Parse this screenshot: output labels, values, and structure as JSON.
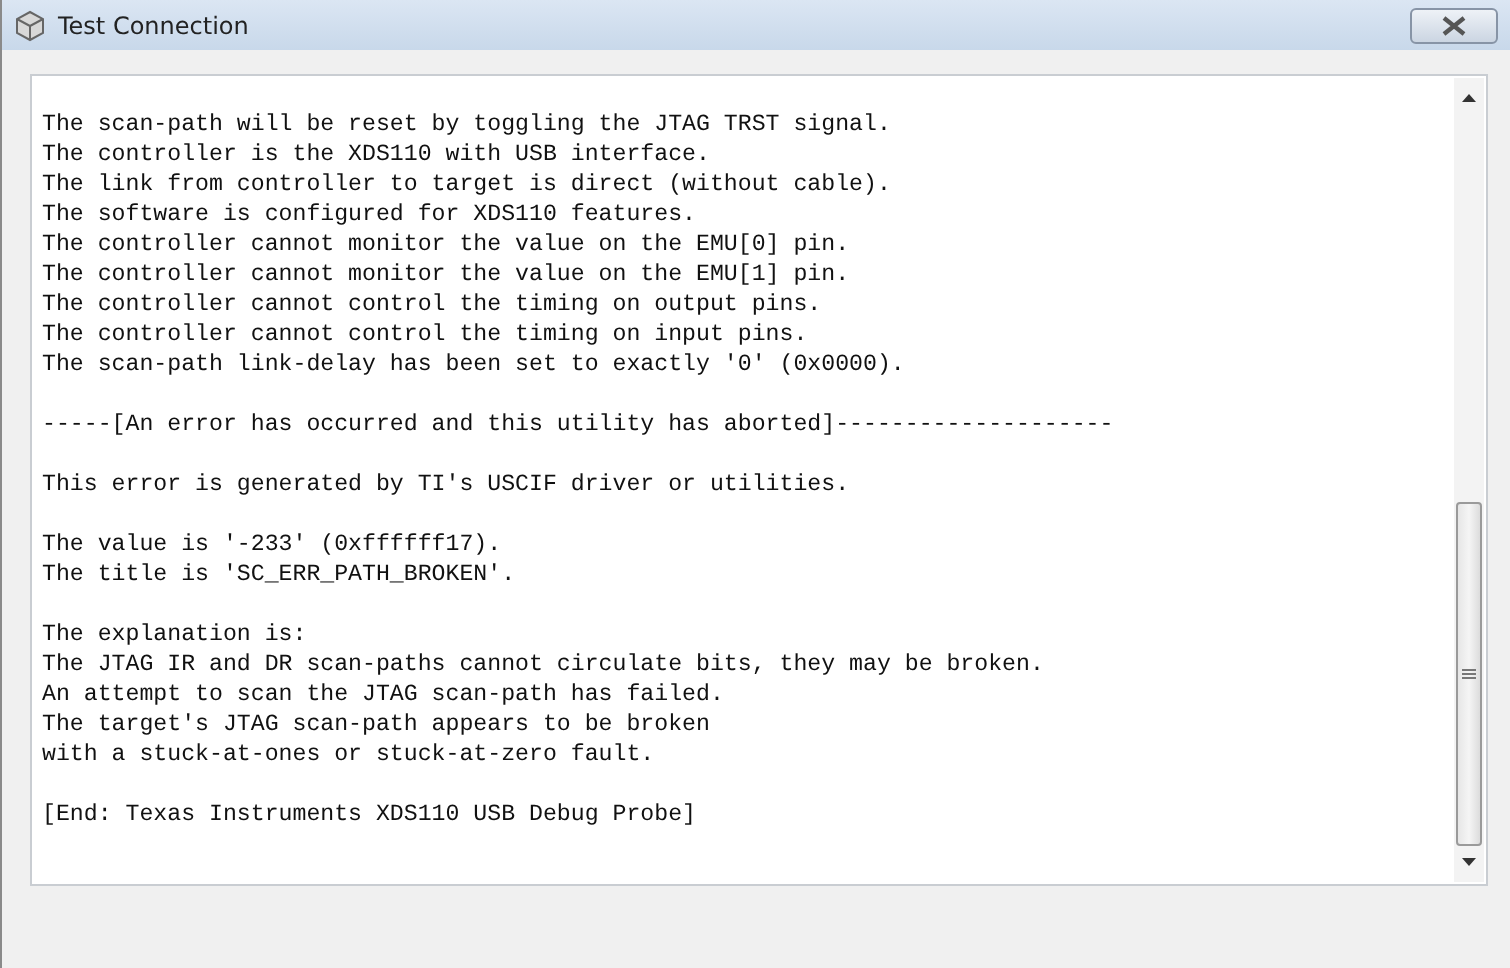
{
  "window": {
    "title": "Test Connection"
  },
  "output": {
    "paragraphs": [
      [
        "The scan-path will be reset by toggling the JTAG TRST signal.",
        "The controller is the XDS110 with USB interface.",
        "The link from controller to target is direct (without cable).",
        "The software is configured for XDS110 features.",
        "The controller cannot monitor the value on the EMU[0] pin.",
        "The controller cannot monitor the value on the EMU[1] pin.",
        "The controller cannot control the timing on output pins.",
        "The controller cannot control the timing on input pins.",
        "The scan-path link-delay has been set to exactly '0' (0x0000)."
      ],
      [
        "-----[An error has occurred and this utility has aborted]--------------------"
      ],
      [
        "This error is generated by TI's USCIF driver or utilities."
      ],
      [
        "The value is '-233' (0xffffff17).",
        "The title is 'SC_ERR_PATH_BROKEN'."
      ],
      [
        "The explanation is:",
        "The JTAG IR and DR scan-paths cannot circulate bits, they may be broken.",
        "An attempt to scan the JTAG scan-path has failed.",
        "The target's JTAG scan-path appears to be broken",
        "with a stuck-at-ones or stuck-at-zero fault."
      ],
      [
        "[End: Texas Instruments XDS110 USB Debug Probe]"
      ]
    ]
  }
}
